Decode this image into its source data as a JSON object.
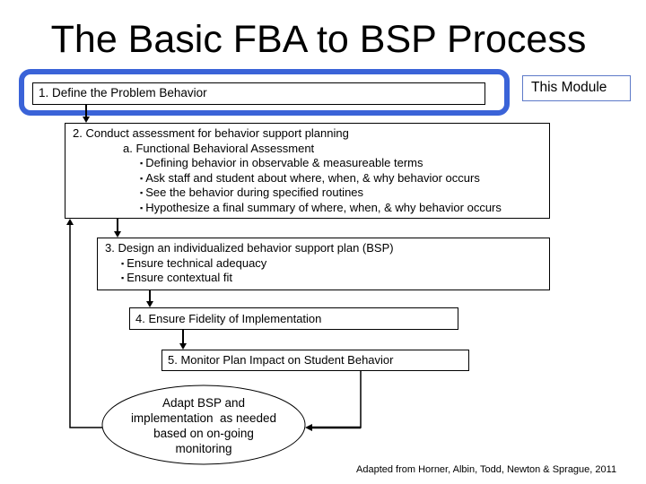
{
  "title": "The Basic FBA to BSP Process",
  "highlight_color": "#3a63d8",
  "module_label": "This Module",
  "steps": {
    "step1": {
      "label": "1. Define the Problem Behavior"
    },
    "step2": {
      "label": "2. Conduct assessment for behavior support planning",
      "sub_label": "a. Functional Behavioral Assessment",
      "bullets": [
        "Defining behavior in observable & measureable terms",
        "Ask staff and student about where, when, & why behavior occurs",
        "See the behavior during specified routines",
        "Hypothesize a final summary of where, when, & why behavior occurs"
      ]
    },
    "step3": {
      "label": "3. Design an individualized behavior support plan (BSP)",
      "bullets": [
        "Ensure technical adequacy",
        "Ensure contextual fit"
      ]
    },
    "step4": {
      "label": "4. Ensure Fidelity of Implementation"
    },
    "step5": {
      "label": "5. Monitor Plan Impact on Student Behavior"
    }
  },
  "adapt_node": {
    "lines": [
      "Adapt BSP and",
      "implementation  as needed",
      "based on on-going",
      "monitoring"
    ]
  },
  "bullet_glyph": "▪",
  "credit": "Adapted from Horner, Albin, Todd, Newton & Sprague, 2011"
}
